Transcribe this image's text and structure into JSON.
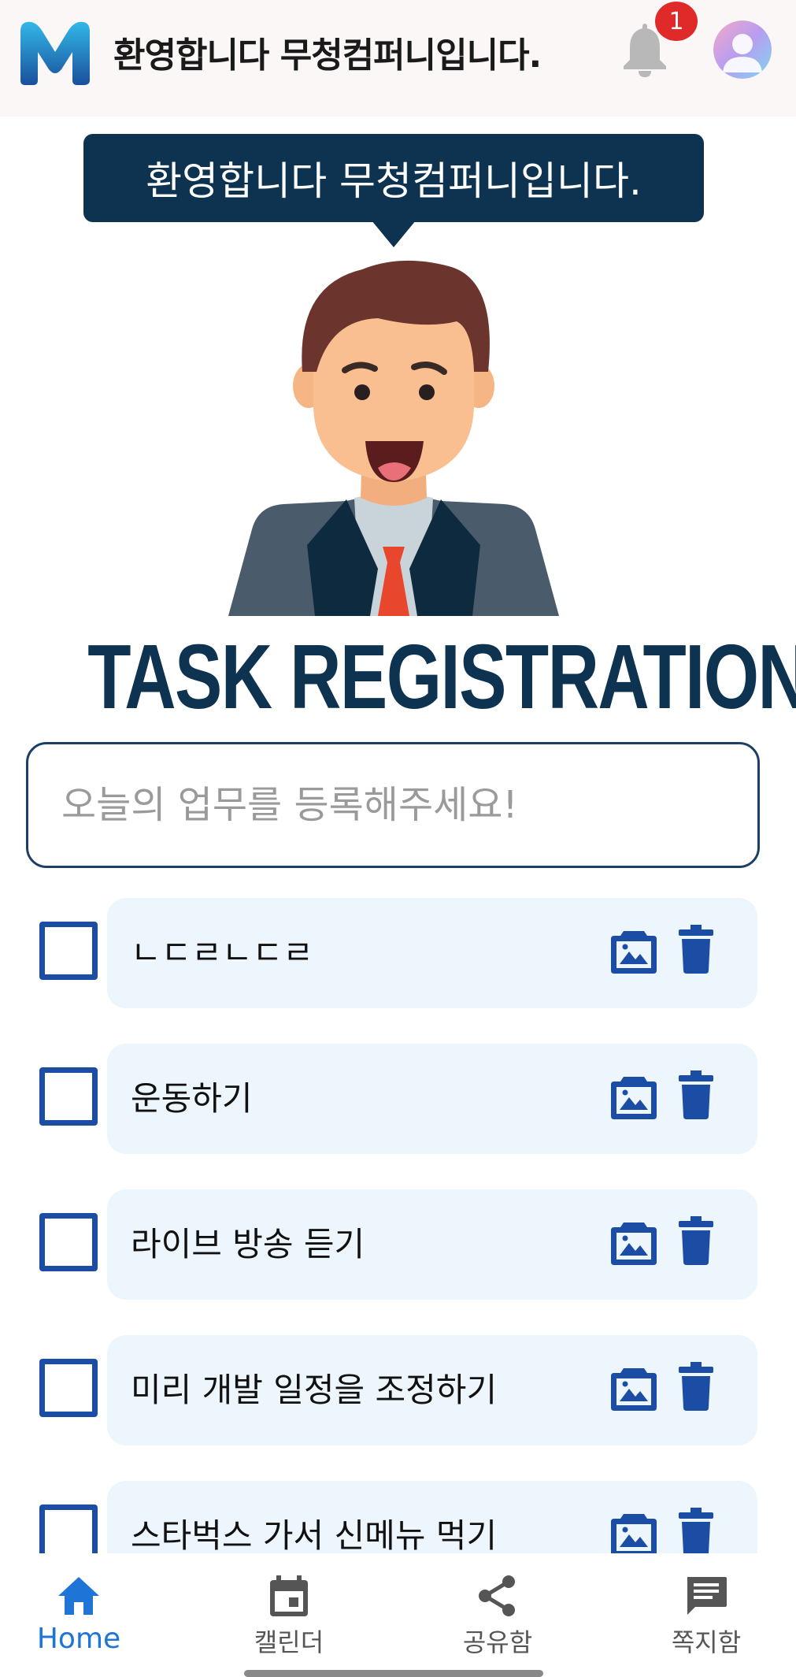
{
  "header": {
    "title": "환영합니다 무청컴퍼니입니다.",
    "notification_count": "1"
  },
  "bubble": {
    "text": "환영합니다 무청컴퍼니입니다."
  },
  "page_title": "TASK REGISTRATION",
  "task_input": {
    "value": "",
    "placeholder": "오늘의 업무를 등록해주세요!"
  },
  "tasks": [
    {
      "text": "ㄴㄷㄹㄴㄷㄹ",
      "checked": false
    },
    {
      "text": "운동하기",
      "checked": false
    },
    {
      "text": "라이브 방송 듣기",
      "checked": false
    },
    {
      "text": "미리 개발 일정을 조정하기",
      "checked": false
    },
    {
      "text": "스타벅스 가서 신메뉴 먹기",
      "checked": false
    }
  ],
  "bottom_nav": {
    "items": [
      {
        "label": "Home",
        "icon": "home-icon",
        "active": true
      },
      {
        "label": "캘린더",
        "icon": "calendar-icon",
        "active": false
      },
      {
        "label": "공유함",
        "icon": "share-icon",
        "active": false
      },
      {
        "label": "쪽지함",
        "icon": "message-icon",
        "active": false
      }
    ]
  },
  "colors": {
    "navy": "#0d3350",
    "checkbox_blue": "#1c4da5",
    "card_bg": "#edf5fd",
    "active_nav": "#1f74d8",
    "badge_red": "#e02a2a"
  }
}
